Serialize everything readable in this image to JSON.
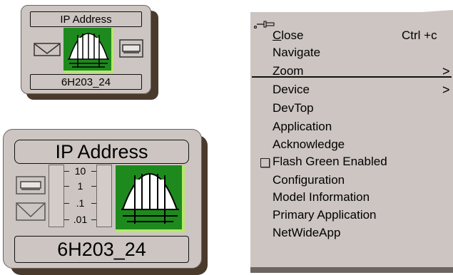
{
  "small_icon": {
    "title": "IP Address",
    "name": "6H203_24"
  },
  "large_icon": {
    "title": "IP Address",
    "name": "6H203_24",
    "meter_ticks": [
      "10",
      "1",
      ".1",
      ".01"
    ]
  },
  "menu": {
    "items": [
      {
        "label": "Close",
        "mnemonic": "C",
        "rest": "lose",
        "accelerator": "Ctrl +c"
      },
      {
        "label": "Navigate"
      },
      {
        "label": "Zoom",
        "submenu": true
      },
      {
        "label": "Device",
        "submenu": true
      },
      {
        "label": "DevTop"
      },
      {
        "label": "Application"
      },
      {
        "label": "Acknowledge"
      },
      {
        "label": "Flash Green Enabled",
        "checkbox": true,
        "checked": false
      },
      {
        "label": "Configuration"
      },
      {
        "label": "Model Information"
      },
      {
        "label": "Primary Application"
      },
      {
        "label": "NetWideApp"
      }
    ],
    "submenu_arrow": ">"
  },
  "colors": {
    "icon_face": "#ccc5c1",
    "icon_shadow": "#4a3a2c",
    "bridge_green": "#1e8a1e",
    "bridge_highlight": "#b6e86a"
  }
}
